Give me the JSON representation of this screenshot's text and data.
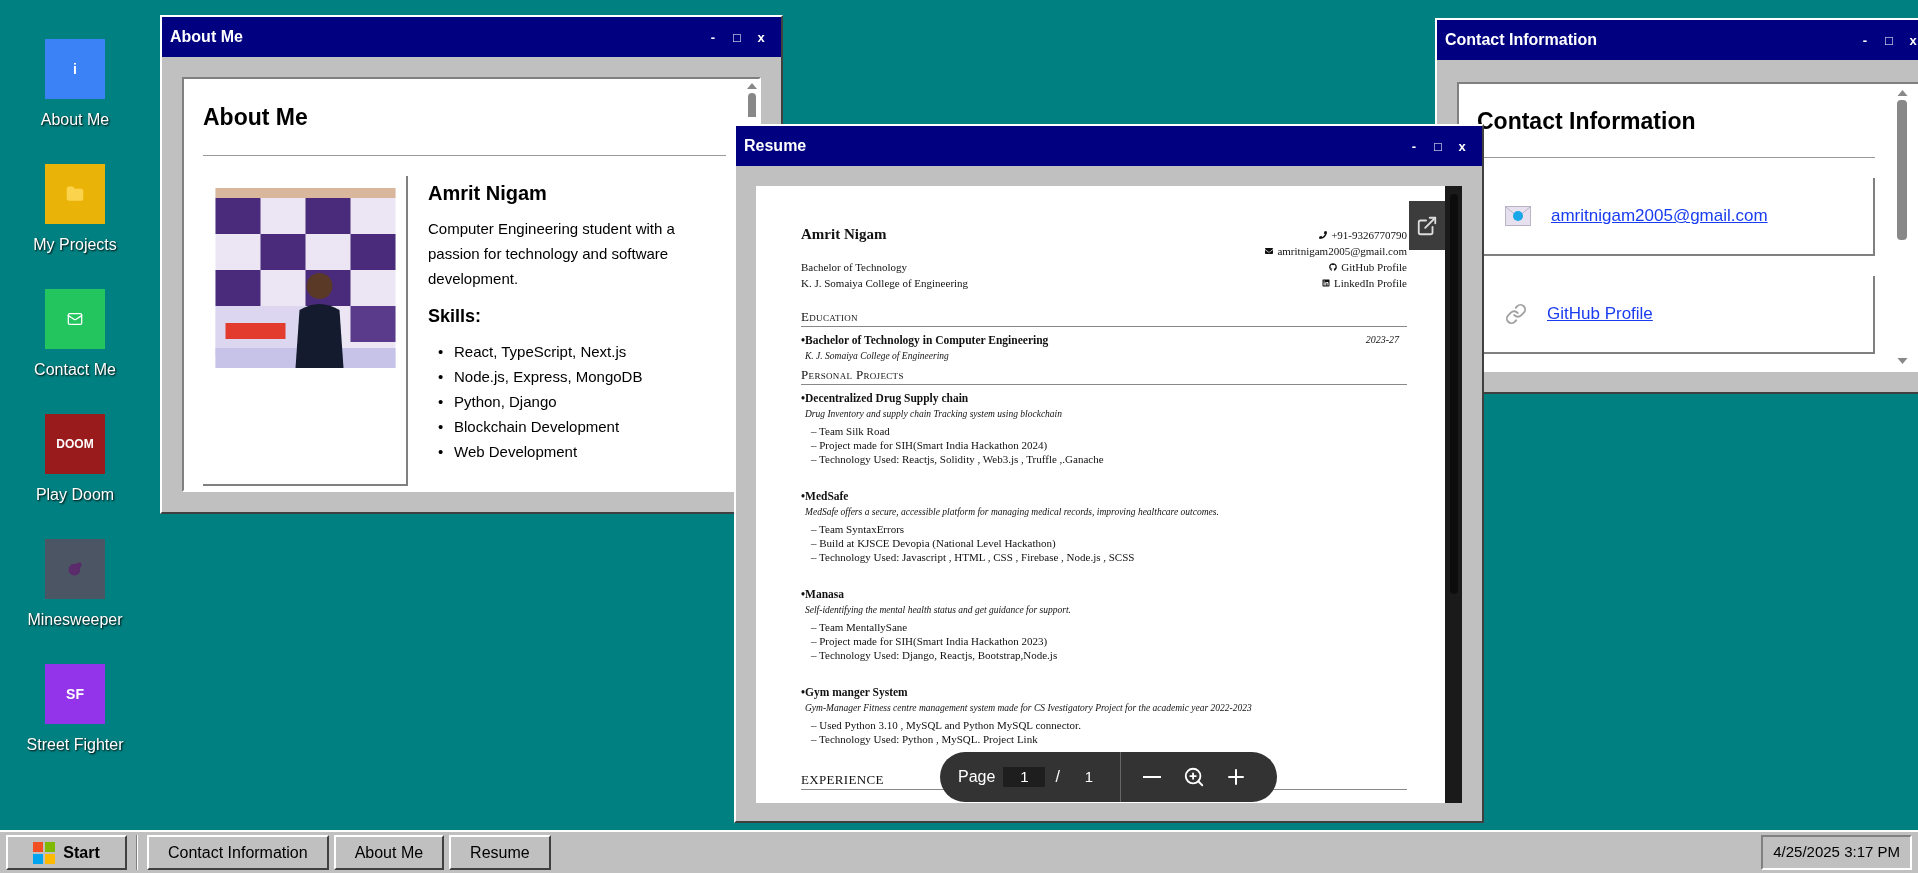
{
  "desktop_icons": [
    {
      "label": "About Me",
      "kind": "text",
      "glyph": "i",
      "color": "#3b82f6"
    },
    {
      "label": "My Projects",
      "kind": "folder",
      "color": "#eab308"
    },
    {
      "label": "Contact Me",
      "kind": "mail",
      "color": "#22c55e"
    },
    {
      "label": "Play Doom",
      "kind": "text",
      "glyph": "DOOM",
      "color": "#991b1b"
    },
    {
      "label": "Minesweeper",
      "kind": "bomb",
      "color": "#4b5563"
    },
    {
      "label": "Street Fighter",
      "kind": "text",
      "glyph": "SF",
      "color": "#9333ea"
    }
  ],
  "about_window": {
    "title": "About Me",
    "controls": [
      "-",
      "□",
      "x"
    ],
    "heading": "About Me",
    "name": "Amrit Nigam",
    "bio": "Computer Engineering student with a passion for technology and software development.",
    "skills_heading": "Skills:",
    "skill_marker": "•",
    "skills": [
      "React, TypeScript, Next.js",
      "Node.js, Express, MongoDB",
      "Python, Django",
      "Blockchain Development",
      "Web Development"
    ]
  },
  "contact_window": {
    "title": "Contact Information",
    "controls": [
      "-",
      "□",
      "x"
    ],
    "heading": "Contact Information",
    "links": [
      {
        "kind": "email",
        "text": "amritnigam2005@gmail.com"
      },
      {
        "kind": "link",
        "text": "GitHub Profile"
      }
    ]
  },
  "resume_window": {
    "title": "Resume",
    "controls": [
      "-",
      "□",
      "x"
    ],
    "document": {
      "name": "Amrit Nigam",
      "degree": "Bachelor of Technology",
      "college": "K. J. Somaiya College of Engineering",
      "contacts": [
        {
          "kind": "phone",
          "text": "+91-9326770790"
        },
        {
          "kind": "email",
          "text": "amritnigam2005@gmail.com"
        },
        {
          "kind": "github",
          "text": "GitHub Profile"
        },
        {
          "kind": "linkedin",
          "text": "LinkedIn Profile"
        }
      ],
      "sections": [
        {
          "heading": "Education",
          "entries": [
            {
              "title": "•Bachelor of Technology in Computer Engineering",
              "date": "2023-27",
              "subtitle": "K. J. Somaiya College of Engineering"
            }
          ]
        },
        {
          "heading": "Personal Projects",
          "entries": [
            {
              "title": "•Decentralized Drug Supply chain",
              "subtitle": "Drug Inventory and supply chain Tracking system using blockchain",
              "bullets": [
                "– Team Silk Road",
                "– Project made for SIH(Smart India Hackathon 2024)",
                "– Technology Used: Reactjs, Solidity , Web3.js , Truffle ,.Ganache"
              ]
            },
            {
              "title": "•MedSafe",
              "subtitle": "MedSafe offers a secure, accessible platform for managing medical records, improving healthcare outcomes.",
              "bullets": [
                "– Team SyntaxErrors",
                "– Build at KJSCE Devopia (National Level Hackathon)",
                "– Technology Used: Javascript , HTML , CSS , Firebase , Node.js , SCSS"
              ]
            },
            {
              "title": "•Manasa",
              "subtitle": "Self-identifying the mental health status and get guidance for support.",
              "bullets": [
                "– Team MentallySane",
                "– Project made for SIH(Smart India Hackathon 2023)",
                "– Technology Used: Django, Reactjs, Bootstrap,Node.js"
              ]
            },
            {
              "title": "•Gym manger System",
              "subtitle": "Gym-Manager Fitness centre management system made for CS Ivestigatory Project for the academic year 2022-2023",
              "bullets": [
                "– Used Python 3.10 , MySQL and Python MySQL connector.",
                "– Technology Used: Python , MySQL. Project Link"
              ]
            }
          ]
        },
        {
          "heading": "EXPERIENCE"
        }
      ]
    },
    "viewer": {
      "page_label": "Page",
      "page": "1",
      "separator": "/",
      "total": "1"
    }
  },
  "taskbar": {
    "start": "Start",
    "items": [
      "Contact Information",
      "About Me",
      "Resume"
    ],
    "clock": "4/25/2025 3:17 PM"
  }
}
